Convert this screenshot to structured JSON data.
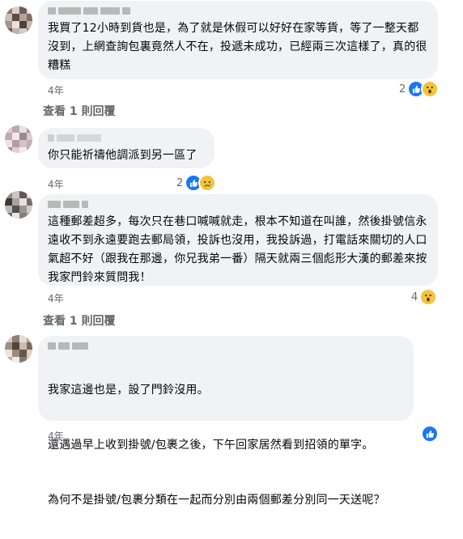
{
  "comments": [
    {
      "text": "我買了12小時到貨也是，為了就是休假可以好好在家等貨，等了一整天都沒到，上網查詢包裏竟然人不在，投遞未成功，已經兩三次這樣了，真的很糟糕",
      "time": "4年",
      "reaction_count": "2",
      "reactions": [
        "like-icon",
        "wow-icon"
      ]
    },
    {
      "text": "你只能祈禱他調派到另一區了",
      "time": "4年",
      "reaction_count": "2",
      "reactions": [
        "like-icon",
        "sad-icon"
      ]
    },
    {
      "text": "這種郵差超多，每次只在巷口喊喊就走，根本不知道在叫誰，然後掛號信永遠收不到永遠要跑去郵局領，投訴也沒用，我投訴過，打電話來關切的人口氣超不好（跟我在那邊，你兄我弟一番）隔天就兩三個彪形大漢的郵差來按我家門鈴來質問我！",
      "time": "4年",
      "reaction_count": "4",
      "reactions": [
        "wow-icon"
      ]
    },
    {
      "paragraphs": [
        "我家這邊也是，設了門鈴沒用。",
        "還遇過早上收到掛號/包裹之後，下午回家居然看到招領的單字。",
        "為何不是掛號/包裹分類在一起而分別由兩個郵差分別同一天送呢？"
      ],
      "time": "4年",
      "reaction_count": "",
      "reactions": [
        "like-icon"
      ]
    }
  ],
  "view_replies_label": "查看 1 則回覆",
  "colors": {
    "bubble": "#f0f2f5",
    "meta": "#65676b",
    "like": "#1877f2",
    "emoji": "#f7c33b"
  }
}
